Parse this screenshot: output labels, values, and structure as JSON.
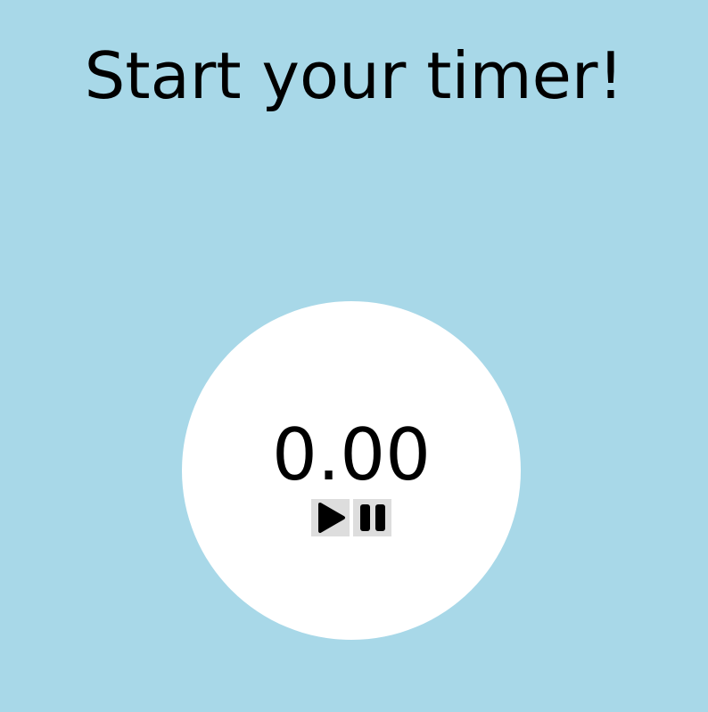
{
  "page": {
    "title": "Start your timer!",
    "background_color": "#a8d8e8"
  },
  "timer": {
    "display": "0.00",
    "circle_color": "#ffffff"
  },
  "controls": {
    "play": {
      "icon": "play-icon",
      "label": "Play"
    },
    "pause": {
      "icon": "pause-icon",
      "label": "Pause"
    },
    "button_color": "#dddddd"
  }
}
